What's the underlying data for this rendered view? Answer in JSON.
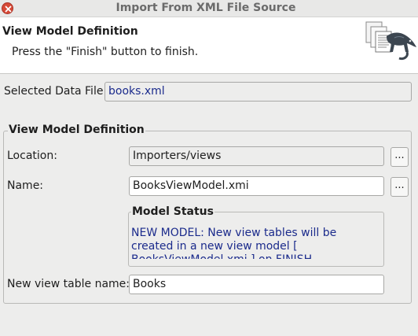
{
  "window": {
    "title": "Import From XML File Source"
  },
  "header": {
    "title": "View Model Definition",
    "message": "Press the \"Finish\" button to finish.",
    "icon": "xml-documents-lizard-icon"
  },
  "data_file": {
    "label": "Selected Data File:",
    "value": "books.xml"
  },
  "view_model_definition": {
    "title": "View Model Definition",
    "location": {
      "label": "Location:",
      "value": "Importers/views",
      "browse_label": "..."
    },
    "name": {
      "label": "Name:",
      "value": "BooksViewModel.xmi",
      "browse_label": "..."
    },
    "model_status": {
      "title": "Model Status",
      "text": "NEW MODEL: New view tables will be created in a new view model [ BooksViewModel.xmi ] on FINISH"
    },
    "view_table_name": {
      "label": "New view table name:",
      "value": "Books"
    }
  },
  "colors": {
    "value_text_blue": "#1b2b8c",
    "close_button_red": "#d64937"
  }
}
